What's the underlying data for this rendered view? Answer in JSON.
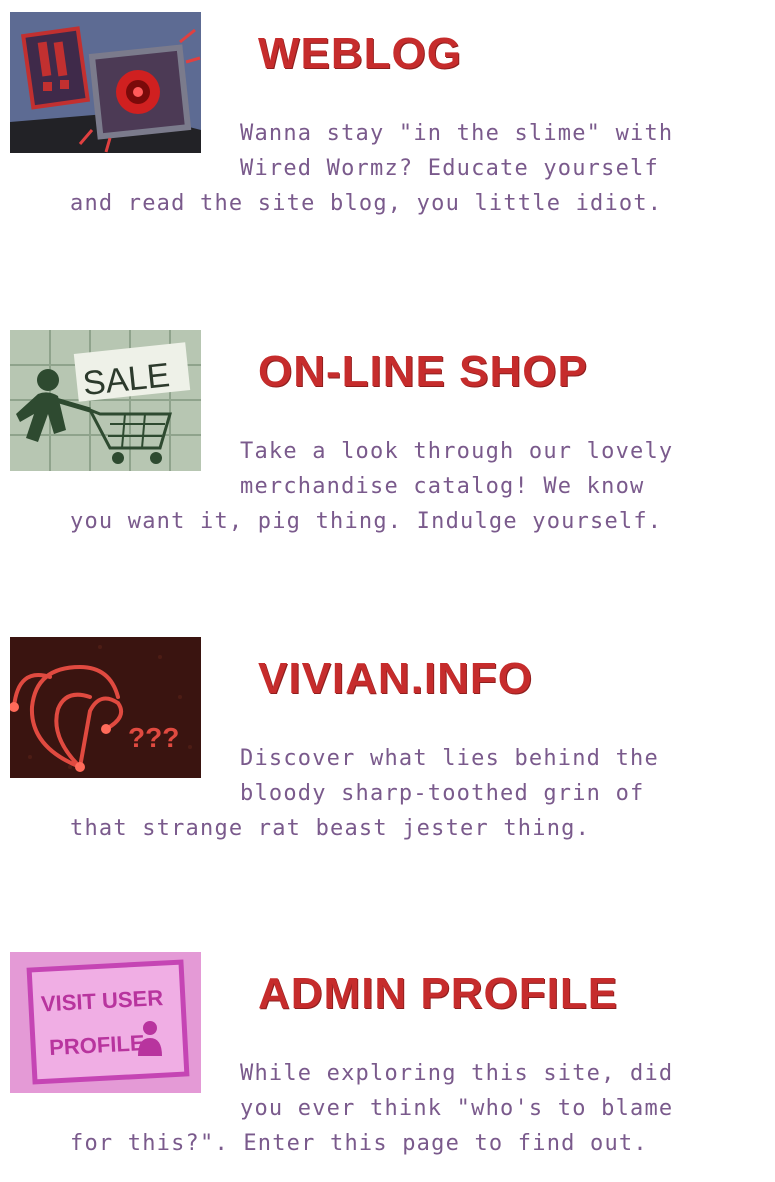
{
  "theme": {
    "accent": "#c62c2c",
    "text": "#7a5a8c"
  },
  "sections": [
    {
      "title": "WEBLOG",
      "thumbnail_icon": "alarm-monitor-icon",
      "lines": [
        "Wanna stay \"in the slime\" with",
        "Wired Wormz? Educate yourself",
        "and read the site blog, you little idiot."
      ]
    },
    {
      "title": "ON-LINE SHOP",
      "thumbnail_icon": "shopping-cart-icon",
      "thumbnail_text": "SALE",
      "lines": [
        "Take a look through our lovely",
        "merchandise catalog! We know",
        "you want it, pig thing. Indulge yourself."
      ]
    },
    {
      "title": "VIVIAN.INFO",
      "thumbnail_icon": "jester-hat-icon",
      "thumbnail_text": "???",
      "lines": [
        "Discover what lies behind the",
        "bloody sharp-toothed grin of",
        "that strange rat beast jester thing."
      ]
    },
    {
      "title": "ADMIN PROFILE",
      "thumbnail_icon": "user-profile-icon",
      "thumbnail_text": [
        "VISIT USER",
        "PROFILE"
      ],
      "lines": [
        "While exploring this site, did",
        "you ever think \"who's to blame",
        "for this?\". Enter this page to find out."
      ]
    }
  ]
}
